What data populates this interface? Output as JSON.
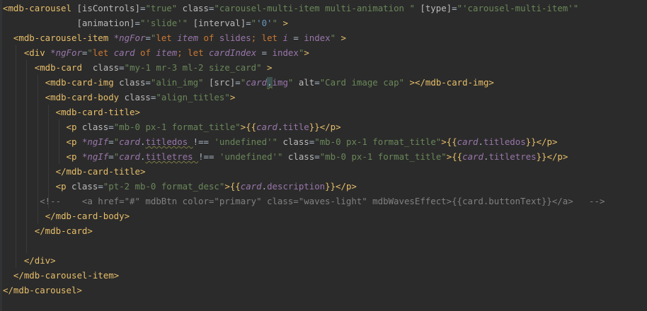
{
  "lines": [
    [
      [
        "tag",
        "<mdb-carousel "
      ],
      [
        "attr",
        "[isControls]"
      ],
      [
        "txt",
        "="
      ],
      [
        "str",
        "\"true\" "
      ],
      [
        "attr",
        "class"
      ],
      [
        "txt",
        "="
      ],
      [
        "str",
        "\"carousel-multi-item multi-animation \" "
      ],
      [
        "attr",
        "[type]"
      ],
      [
        "txt",
        "="
      ],
      [
        "str",
        "\"'carousel-multi-item'\""
      ]
    ],
    [
      [
        "txt",
        "              "
      ],
      [
        "attr",
        "[animation]"
      ],
      [
        "txt",
        "="
      ],
      [
        "str",
        "\"'slide'\" "
      ],
      [
        "attr",
        "[interval]"
      ],
      [
        "txt",
        "="
      ],
      [
        "str",
        "\""
      ],
      [
        "num",
        "'0'"
      ],
      [
        "str",
        "\" "
      ],
      [
        "tag",
        ">"
      ]
    ],
    [
      [
        "txt",
        "  "
      ],
      [
        "tag",
        "<mdb-carousel-item "
      ],
      [
        "var",
        "*ngFor"
      ],
      [
        "txt",
        "="
      ],
      [
        "str",
        "\""
      ],
      [
        "kw",
        "let "
      ],
      [
        "var",
        "item "
      ],
      [
        "kw",
        "of "
      ],
      [
        "prop",
        "slides"
      ],
      [
        "kw",
        "; let "
      ],
      [
        "var",
        "i "
      ],
      [
        "txt",
        "= "
      ],
      [
        "prop",
        "index"
      ],
      [
        "str",
        "\" "
      ],
      [
        "tag",
        ">"
      ]
    ],
    [
      [
        "txt",
        "    "
      ],
      [
        "tag",
        "<div "
      ],
      [
        "var",
        "*ngFor"
      ],
      [
        "txt",
        "="
      ],
      [
        "str",
        "\""
      ],
      [
        "kw",
        "let "
      ],
      [
        "var",
        "card "
      ],
      [
        "kw",
        "of "
      ],
      [
        "var",
        "item"
      ],
      [
        "kw",
        "; let "
      ],
      [
        "var",
        "cardIndex "
      ],
      [
        "txt",
        "= "
      ],
      [
        "prop",
        "index"
      ],
      [
        "str",
        "\""
      ],
      [
        "tag",
        ">"
      ]
    ],
    [
      [
        "txt",
        "      "
      ],
      [
        "tag",
        "<mdb-card  "
      ],
      [
        "attr",
        "class"
      ],
      [
        "txt",
        "="
      ],
      [
        "str",
        "\"my-1 mr-3 ml-2 size_card\" "
      ],
      [
        "tag",
        ">"
      ]
    ],
    [
      [
        "txt",
        "        "
      ],
      [
        "tag",
        "<mdb-card-img "
      ],
      [
        "attr",
        "class"
      ],
      [
        "txt",
        "="
      ],
      [
        "str",
        "\"alin_img\" "
      ],
      [
        "attr",
        "[src]"
      ],
      [
        "txt",
        "="
      ],
      [
        "str",
        "\""
      ],
      [
        "var",
        "card"
      ],
      [
        "txt",
        "."
      ],
      [
        "prop",
        "img"
      ],
      [
        "str",
        "\" "
      ],
      [
        "attr",
        "alt"
      ],
      [
        "txt",
        "="
      ],
      [
        "str",
        "\"Card image cap\" "
      ],
      [
        "tag",
        "></mdb-card-img>"
      ]
    ],
    [
      [
        "txt",
        "        "
      ],
      [
        "tag",
        "<mdb-card-body "
      ],
      [
        "attr",
        "class"
      ],
      [
        "txt",
        "="
      ],
      [
        "str",
        "\"align_titles\""
      ],
      [
        "tag",
        ">"
      ]
    ],
    [
      [
        "txt",
        "          "
      ],
      [
        "tag",
        "<mdb-card-title>"
      ]
    ],
    [
      [
        "txt",
        "            "
      ],
      [
        "tag",
        "<p "
      ],
      [
        "attr",
        "class"
      ],
      [
        "txt",
        "="
      ],
      [
        "str",
        "\"mb-0 px-1 format_title\""
      ],
      [
        "tag",
        ">"
      ],
      [
        "brace",
        "{{"
      ],
      [
        "var",
        "card"
      ],
      [
        "txt",
        "."
      ],
      [
        "prop",
        "title"
      ],
      [
        "brace",
        "}}"
      ],
      [
        "tag",
        "</p>"
      ]
    ],
    [
      [
        "txt",
        "            "
      ],
      [
        "tag",
        "<p "
      ],
      [
        "var",
        "*ngIf"
      ],
      [
        "txt",
        "="
      ],
      [
        "str",
        "\""
      ],
      [
        "var",
        "card"
      ],
      [
        "txt",
        "."
      ],
      [
        "prop",
        "titledos "
      ],
      [
        "txt",
        "!== "
      ],
      [
        "str2",
        "'undefined'"
      ],
      [
        "str",
        "\" "
      ],
      [
        "attr",
        "class"
      ],
      [
        "txt",
        "="
      ],
      [
        "str",
        "\"mb-0 px-1 format_title\""
      ],
      [
        "tag",
        ">"
      ],
      [
        "brace",
        "{{"
      ],
      [
        "var",
        "card"
      ],
      [
        "txt",
        "."
      ],
      [
        "prop",
        "titledos"
      ],
      [
        "brace",
        "}}"
      ],
      [
        "tag",
        "</p>"
      ]
    ],
    [
      [
        "txt",
        "            "
      ],
      [
        "tag",
        "<p "
      ],
      [
        "var",
        "*ngIf"
      ],
      [
        "txt",
        "="
      ],
      [
        "str",
        "\""
      ],
      [
        "var",
        "card"
      ],
      [
        "txt",
        "."
      ],
      [
        "prop",
        "titletres "
      ],
      [
        "txt",
        "!== "
      ],
      [
        "str2",
        "'undefined'"
      ],
      [
        "str",
        "\" "
      ],
      [
        "attr",
        "class"
      ],
      [
        "txt",
        "="
      ],
      [
        "str",
        "\"mb-0 px-1 format_title\""
      ],
      [
        "tag",
        ">"
      ],
      [
        "brace",
        "{{"
      ],
      [
        "var",
        "card"
      ],
      [
        "txt",
        "."
      ],
      [
        "prop",
        "titletres"
      ],
      [
        "brace",
        "}}"
      ],
      [
        "tag",
        "</p>"
      ]
    ],
    [
      [
        "txt",
        "          "
      ],
      [
        "tag",
        "</mdb-card-title>"
      ]
    ],
    [
      [
        "txt",
        "          "
      ],
      [
        "tag",
        "<p "
      ],
      [
        "attr",
        "class"
      ],
      [
        "txt",
        "="
      ],
      [
        "str",
        "\"pt-2 mb-0 format_desc\""
      ],
      [
        "tag",
        ">"
      ],
      [
        "brace",
        "{{"
      ],
      [
        "var",
        "card"
      ],
      [
        "txt",
        "."
      ],
      [
        "prop",
        "description"
      ],
      [
        "brace",
        "}}"
      ],
      [
        "tag",
        "</p>"
      ]
    ],
    [
      [
        "cm",
        "       <!--    <a href=\"#\" mdbBtn color=\"primary\" class=\"waves-light\" mdbWavesEffect>{{card.buttonText}}</a>   -->"
      ]
    ],
    [
      [
        "txt",
        "        "
      ],
      [
        "tag",
        "</mdb-card-body>"
      ]
    ],
    [
      [
        "txt",
        "      "
      ],
      [
        "tag",
        "</mdb-card>"
      ]
    ],
    [
      [
        "txt",
        ""
      ]
    ],
    [
      [
        "txt",
        "    "
      ],
      [
        "tag",
        "</div>"
      ]
    ],
    [
      [
        "txt",
        "  "
      ],
      [
        "tag",
        "</mdb-carousel-item>"
      ]
    ],
    [
      [
        "tag",
        "</mdb-carousel>"
      ]
    ]
  ]
}
